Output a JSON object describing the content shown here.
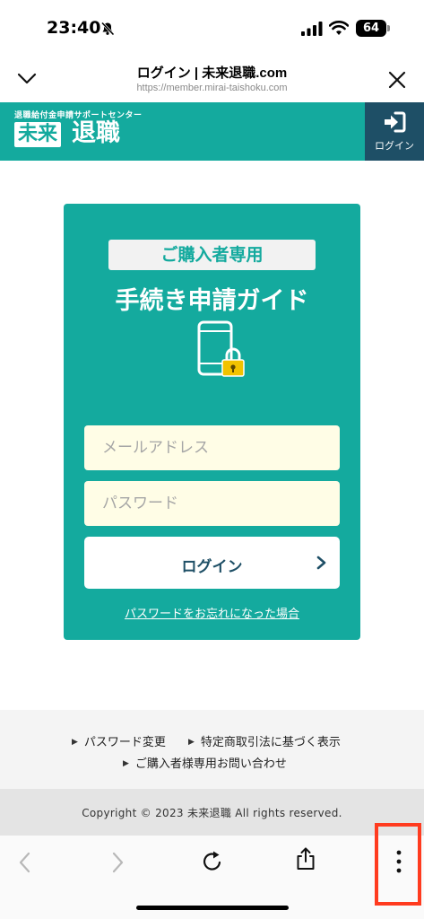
{
  "status_bar": {
    "time": "23:40",
    "battery": "64",
    "icons": [
      "bell-slash-icon",
      "signal-icon",
      "wifi-icon",
      "battery-icon"
    ]
  },
  "browser": {
    "title": "ログイン | 未来退職.com",
    "url": "https://member.mirai-taishoku.com",
    "icons": [
      "chevron-down-icon",
      "close-icon"
    ]
  },
  "site_header": {
    "logo_sub": "退職給付金申請サポートセンター",
    "logo_box": "未来",
    "logo_main": "退職",
    "login_label": "ログイン",
    "brand_color": "#14aa9e",
    "login_bg_color": "#1e4f66"
  },
  "card": {
    "badge": "ご購入者専用",
    "title": "手続き申請ガイド",
    "email_placeholder": "メールアドレス",
    "password_placeholder": "パスワード",
    "login_button": "ログイン",
    "forgot_link": "パスワードをお忘れになった場合",
    "input_bg_color": "#fffde6"
  },
  "footer": {
    "links": [
      "パスワード変更",
      "特定商取引法に基づく表示",
      "ご購入者様専用お問い合わせ"
    ],
    "copyright": "Copyright © 2023 未来退職 All rights reserved."
  },
  "toolbar": {
    "icons": [
      "back-icon",
      "forward-icon",
      "reload-icon",
      "share-icon",
      "more-icon"
    ],
    "highlight_color": "#ff3b1f"
  }
}
